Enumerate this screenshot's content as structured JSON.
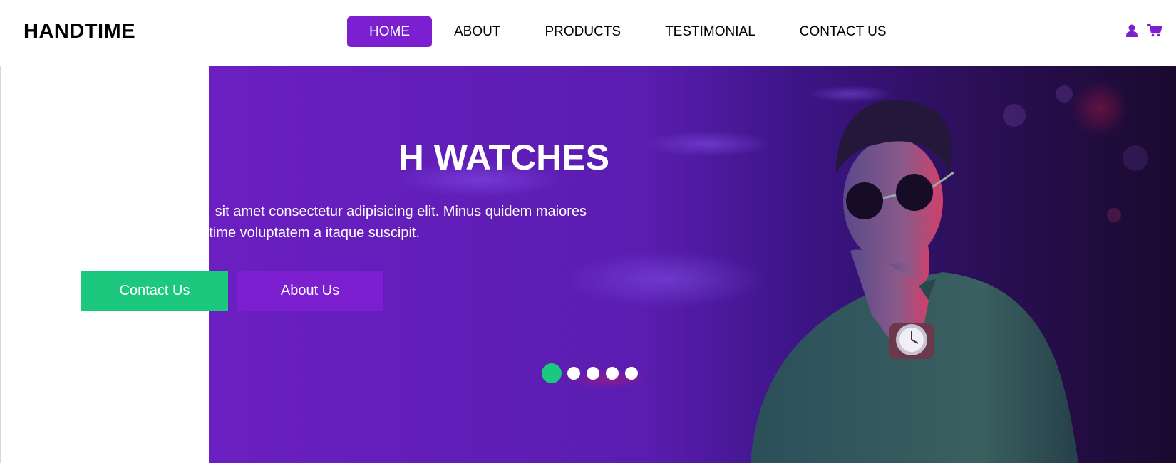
{
  "brand": {
    "logo_text": "HANDTIME"
  },
  "nav": {
    "items": [
      {
        "label": "HOME",
        "active": true
      },
      {
        "label": "ABOUT",
        "active": false
      },
      {
        "label": "PRODUCTS",
        "active": false
      },
      {
        "label": "TESTIMONIAL",
        "active": false
      },
      {
        "label": "CONTACT US",
        "active": false
      }
    ],
    "icons": [
      "user-icon",
      "cart-icon"
    ]
  },
  "hero": {
    "title_visible": "H WATCHES",
    "text_line1": "sit amet consectetur adipisicing elit. Minus quidem maiores",
    "text_line2": "time voluptatem a itaque suscipit.",
    "contact_label": "Contact Us",
    "about_label": "About Us",
    "carousel": {
      "slide_count": 5,
      "active_index": 0
    }
  },
  "colors": {
    "accent_purple": "#7b1fd0",
    "accent_green": "#1cc77e",
    "hero_purple": "#6a1bbd"
  }
}
